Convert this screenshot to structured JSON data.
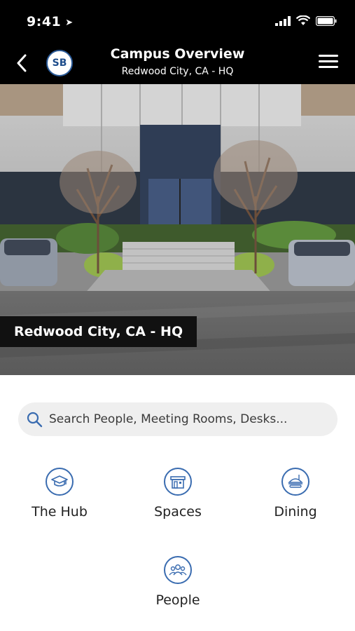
{
  "status_bar": {
    "time": "9:41",
    "icons": [
      "location-arrow-icon",
      "cellular-signal-icon",
      "wifi-icon",
      "battery-icon"
    ]
  },
  "header": {
    "avatar_initials": "SB",
    "title": "Campus Overview",
    "subtitle": "Redwood City, CA - HQ",
    "back_icon": "chevron-left-icon",
    "menu_icon": "hamburger-menu-icon"
  },
  "hero": {
    "label": "Redwood City, CA - HQ"
  },
  "search": {
    "placeholder": "Search People, Meeting Rooms, Desks...",
    "icon": "search-icon"
  },
  "tiles": [
    {
      "label": "The Hub",
      "icon": "graduation-cap-icon"
    },
    {
      "label": "Spaces",
      "icon": "building-icon"
    },
    {
      "label": "Dining",
      "icon": "food-icon"
    },
    {
      "label": "People",
      "icon": "people-group-icon"
    }
  ],
  "colors": {
    "accent": "#3a6cb0",
    "header_bg": "#000000",
    "search_bg": "#efefef"
  }
}
